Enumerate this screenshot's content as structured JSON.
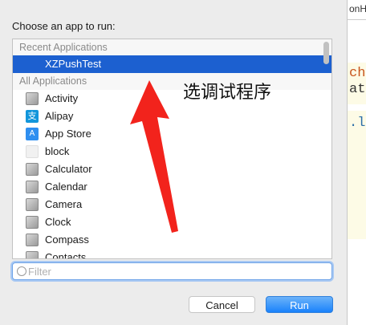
{
  "dialog": {
    "title": "Choose an app to run:",
    "sections": {
      "recent": "Recent Applications",
      "all": "All Applications"
    },
    "recent_items": [
      {
        "label": "XZPushTest",
        "icon": "app-icon",
        "selected": true
      }
    ],
    "all_items": [
      {
        "label": "Activity",
        "icon": "activity-monitor-icon"
      },
      {
        "label": "Alipay",
        "icon": "alipay-icon",
        "glyph": "支"
      },
      {
        "label": "App Store",
        "icon": "app-store-icon",
        "glyph": "A"
      },
      {
        "label": "block",
        "icon": "blank-app-icon"
      },
      {
        "label": "Calculator",
        "icon": "calculator-icon"
      },
      {
        "label": "Calendar",
        "icon": "calendar-icon"
      },
      {
        "label": "Camera",
        "icon": "camera-icon"
      },
      {
        "label": "Clock",
        "icon": "clock-icon"
      },
      {
        "label": "Compass",
        "icon": "compass-icon"
      },
      {
        "label": "Contacts",
        "icon": "contacts-icon"
      }
    ],
    "filter": {
      "placeholder": "Filter",
      "value": ""
    },
    "buttons": {
      "cancel": "Cancel",
      "run": "Run"
    }
  },
  "annotation": {
    "text": "选调试程序",
    "arrow_color": "#f2231c"
  },
  "background_editor": {
    "snippets": [
      "onHa",
      "ch",
      "at",
      ".l"
    ]
  },
  "colors": {
    "selection": "#1c60d0",
    "run_button": "#1a82fb",
    "filter_focus": "#6fa4e8"
  }
}
